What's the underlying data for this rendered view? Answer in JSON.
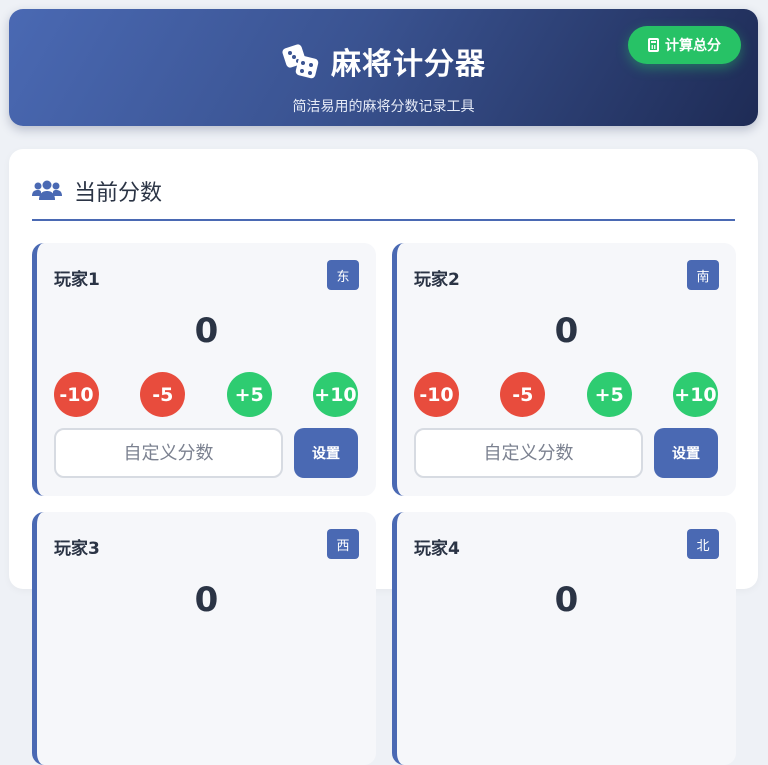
{
  "header": {
    "title": "麻将计分器",
    "subtitle": "简洁易用的麻将分数记录工具",
    "total_button_label": "计算总分"
  },
  "section": {
    "title": "当前分数"
  },
  "players": [
    {
      "name": "玩家1",
      "wind": "东",
      "score": "0"
    },
    {
      "name": "玩家2",
      "wind": "南",
      "score": "0"
    },
    {
      "name": "玩家3",
      "wind": "西",
      "score": "0"
    },
    {
      "name": "玩家4",
      "wind": "北",
      "score": "0"
    }
  ],
  "score_buttons": {
    "minus10": "-10",
    "minus5": "-5",
    "plus5": "+5",
    "plus10": "+10"
  },
  "custom": {
    "placeholder": "自定义分数",
    "set_label": "设置"
  },
  "colors": {
    "primary": "#4a69b3",
    "positive": "#2ecc71",
    "negative": "#e84c3d",
    "total_button": "#27c266"
  },
  "icons": {
    "title_icon": "dice-icon",
    "total_button_icon": "calculator-icon",
    "section_icon": "users-icon"
  }
}
